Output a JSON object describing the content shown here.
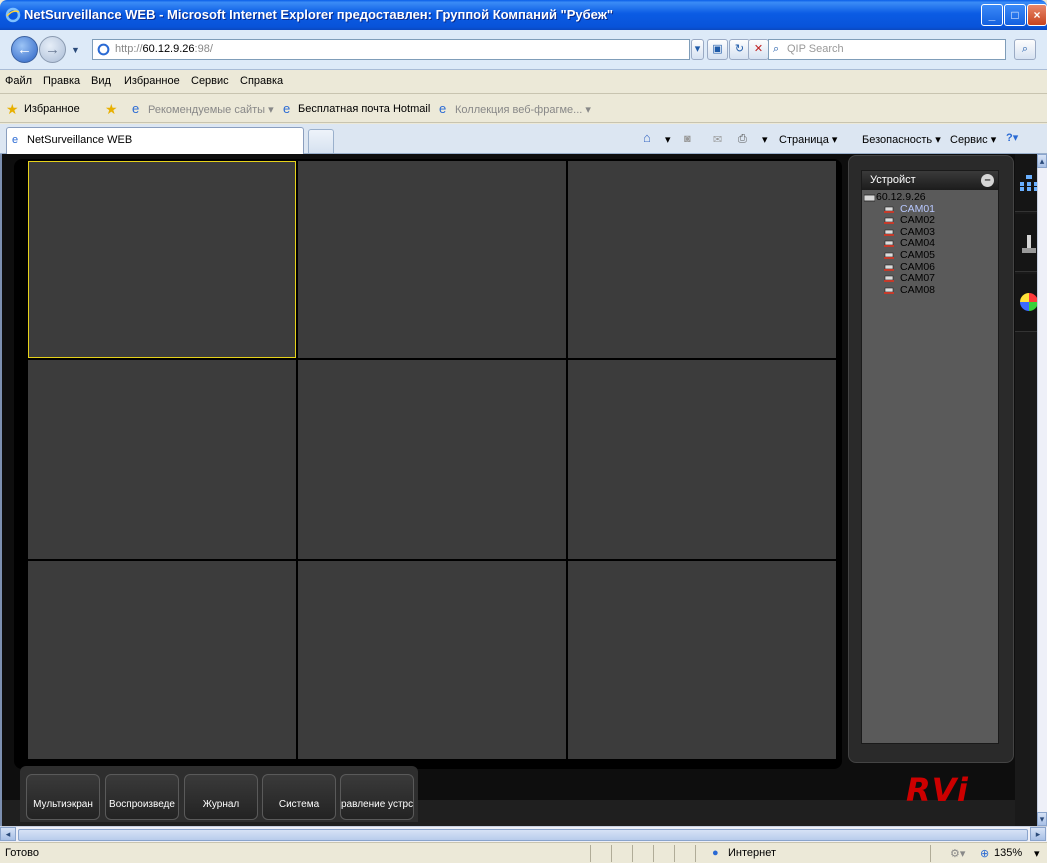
{
  "window": {
    "title": "NetSurveillance WEB - Microsoft Internet Explorer предоставлен: Группой Компаний \"Рубеж\"",
    "controls": [
      "minimize",
      "maximize",
      "close"
    ]
  },
  "address_bar": {
    "protocol": "http://",
    "host": "60.12.9.26",
    "port": ":98/",
    "search_placeholder": "QIP Search"
  },
  "menu": [
    "Файл",
    "Правка",
    "Вид",
    "Избранное",
    "Сервис",
    "Справка"
  ],
  "favorites_bar": {
    "favorites_label": "Избранное",
    "items": [
      "Рекомендуемые сайты ▾",
      "Бесплатная почта Hotmail",
      "Коллекция веб-фрагме... ▾"
    ]
  },
  "tab": {
    "title": "NetSurveillance WEB"
  },
  "command_bar": {
    "page": "Страница ▾",
    "safety": "Безопасность ▾",
    "tools": "Сервис ▾"
  },
  "device_panel": {
    "header": "Устройст",
    "root": "60.12.9.26",
    "cameras": [
      "CAM01",
      "CAM02",
      "CAM03",
      "CAM04",
      "CAM05",
      "CAM06",
      "CAM07",
      "CAM08"
    ],
    "active_camera_index": 0
  },
  "bottom_buttons": [
    "Мультиэкран",
    "Воспроизведе",
    "Журнал",
    "Система",
    "равление устрс"
  ],
  "logo": "RVi",
  "status_bar": {
    "status": "Готово",
    "zone": "Интернет",
    "zoom": "135%"
  },
  "colors": {
    "cell_bg": "#3c3c3c",
    "selected_outline": "#e6d21a",
    "active_camera": "#b8c8ff",
    "logo": "#cc0000"
  }
}
